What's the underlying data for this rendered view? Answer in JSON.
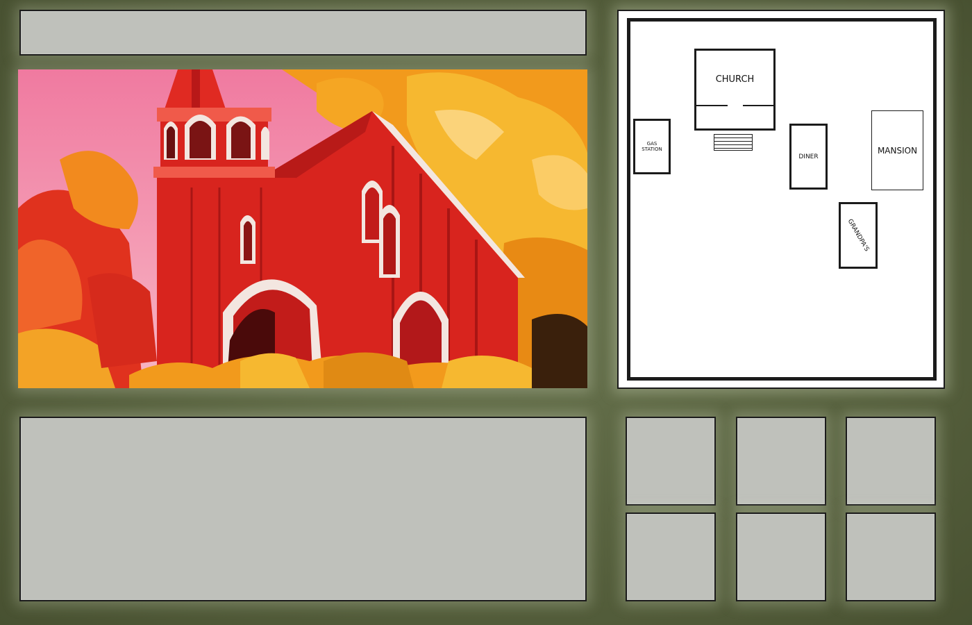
{
  "map": {
    "locations": [
      {
        "id": "church",
        "label": "CHURCH"
      },
      {
        "id": "gas-station",
        "label": "GAS STATION"
      },
      {
        "id": "diner",
        "label": "DINER"
      },
      {
        "id": "mansion",
        "label": "MANSION"
      },
      {
        "id": "grandpas",
        "label": "GRANDPA'S"
      }
    ]
  },
  "scene": {
    "colors": {
      "sky": "#f08aa8",
      "church_red": "#d8241e",
      "foliage_orange": "#f29a1c",
      "foliage_yellow": "#f6b830",
      "trim": "#f3e6e0"
    }
  },
  "inventory": {
    "slots": [
      "",
      "",
      "",
      "",
      "",
      ""
    ]
  },
  "title": {
    "text": ""
  },
  "dialog": {
    "text": ""
  }
}
